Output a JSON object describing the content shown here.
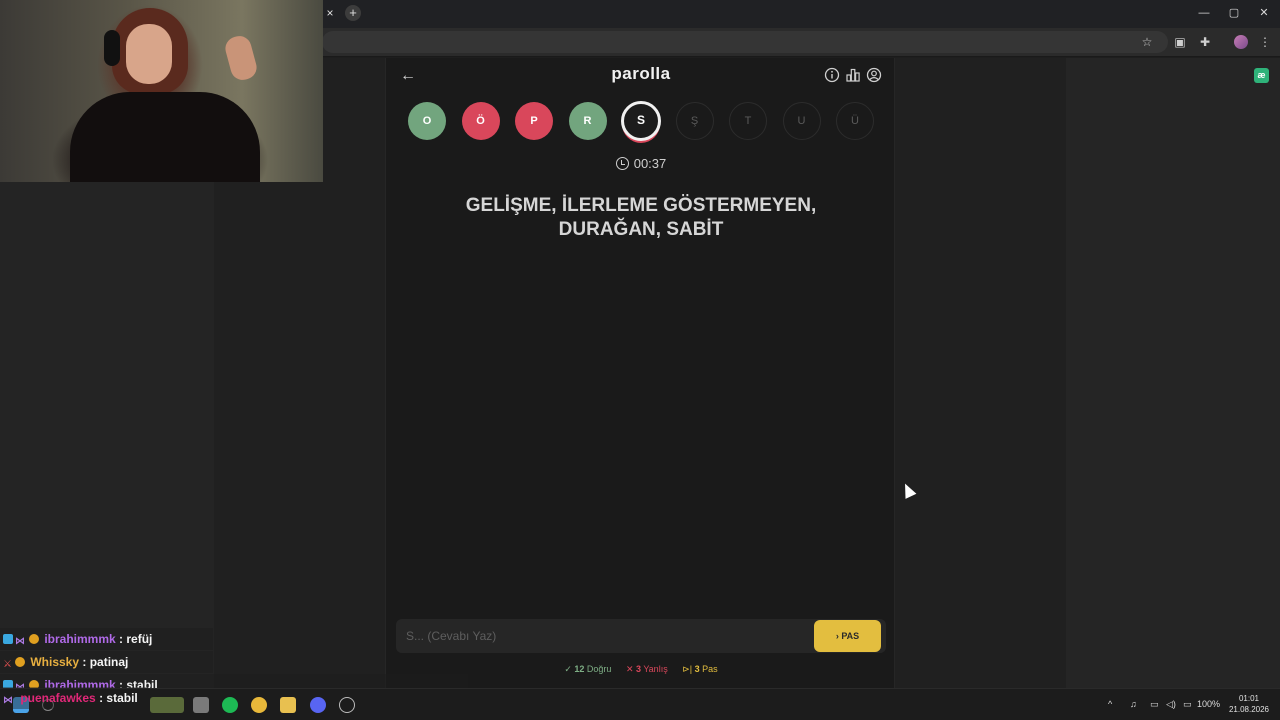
{
  "browser": {
    "close_tab": "×",
    "new_tab": "+",
    "window_controls": [
      "—",
      "▢",
      "✕"
    ],
    "toolbar_icons": [
      "star-icon",
      "reader-icon",
      "extensions-icon",
      "menu-icon"
    ]
  },
  "game": {
    "title": "parolla",
    "header_icons": [
      "info-icon",
      "stats-icon",
      "account-icon"
    ],
    "letters": [
      {
        "char": "O",
        "state": "correct"
      },
      {
        "char": "Ö",
        "state": "wrong"
      },
      {
        "char": "P",
        "state": "wrong"
      },
      {
        "char": "R",
        "state": "correct"
      },
      {
        "char": "S",
        "state": "active"
      },
      {
        "char": "Ş",
        "state": "pending"
      },
      {
        "char": "T",
        "state": "pending"
      },
      {
        "char": "U",
        "state": "pending"
      },
      {
        "char": "Ü",
        "state": "pending"
      }
    ],
    "timer": "00:37",
    "question_line1": "GELİŞME, İLERLEME GÖSTERMEYEN,",
    "question_line2": "DURAĞAN, SABİT",
    "answer_placeholder": "S... (Cevabı Yaz)",
    "pas_button": "PAS",
    "stats": {
      "correct_count": "12",
      "correct_label": "Doğru",
      "wrong_count": "3",
      "wrong_label": "Yanlış",
      "pas_count": "3",
      "pas_label": "Pas"
    },
    "colors": {
      "correct": "#72a57e",
      "wrong": "#d9475b",
      "pas": "#e3be3f"
    }
  },
  "chat": [
    {
      "user": "ibrahimmmk",
      "message": ": refüj",
      "color": "purple"
    },
    {
      "user": "Whissky",
      "message": ": patinaj",
      "color": "gold"
    },
    {
      "user": "ibrahimmmk",
      "message": ": stabil",
      "color": "purple"
    },
    {
      "user": "puenafawkes",
      "message": ": stabil",
      "color": "pink"
    }
  ],
  "taskbar": {
    "battery": "100%",
    "time": "01:01",
    "date": "21.08.2026"
  }
}
